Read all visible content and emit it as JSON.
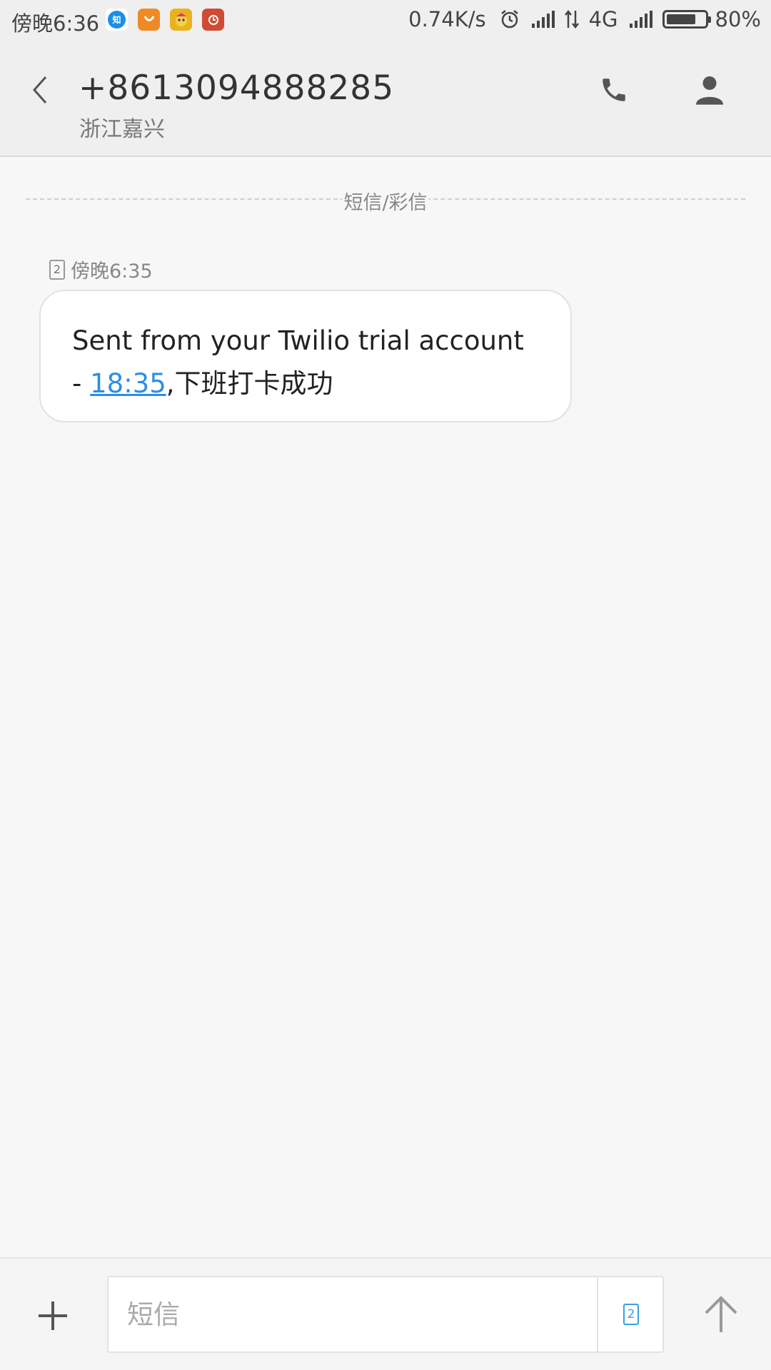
{
  "status_bar": {
    "time": "傍晚6:36",
    "net_speed": "0.74K/s",
    "network_type": "4G",
    "battery_percent": "80%",
    "battery_level": 0.8,
    "app_icons": [
      "zhihu-icon",
      "taobao-icon",
      "game-icon",
      "red-app-icon"
    ],
    "zhihu_glyph": "知"
  },
  "header": {
    "phone_number": "+8613094888285",
    "location": "浙江嘉兴"
  },
  "conversation": {
    "divider_label": "短信/彩信",
    "messages": [
      {
        "sim": "2",
        "time": "傍晚6:35",
        "text_prefix": "Sent from your Twilio trial account - ",
        "link_text": "18:35",
        "text_suffix": ",下班打卡成功"
      }
    ]
  },
  "composer": {
    "placeholder": "短信",
    "sim": "2"
  },
  "colors": {
    "accent": "#2b8ee6",
    "header_bg": "#efefef",
    "page_bg": "#f7f7f7"
  }
}
